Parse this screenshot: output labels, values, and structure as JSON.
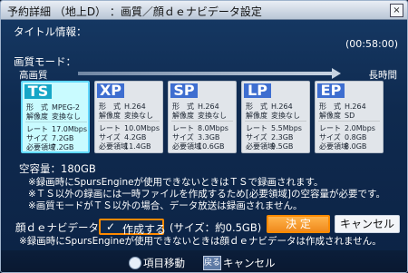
{
  "window": {
    "title": "予約詳細 （地上D） ：画質／顔ｄｅナビデータ設定",
    "close": "×"
  },
  "title_info": {
    "label": "タイトル情報：",
    "duration": "(00:58:00)"
  },
  "quality": {
    "label": "画質モード：",
    "high": "高画質",
    "long": "長時間",
    "modes": [
      {
        "badge": "TS",
        "rows": [
          [
            "形　式",
            "MPEG-2"
          ],
          [
            "解像度",
            "変換なし"
          ],
          [
            "レート",
            "17.0Mbps"
          ],
          [
            "サイズ",
            "7.2GB"
          ],
          [
            "必要領域",
            "7.2GB"
          ]
        ]
      },
      {
        "badge": "XP",
        "rows": [
          [
            "形　式",
            "H.264"
          ],
          [
            "解像度",
            "変換なし"
          ],
          [
            "レート",
            "10.0Mbps"
          ],
          [
            "サイズ",
            "4.2GB"
          ],
          [
            "必要領域",
            "11.4GB"
          ]
        ]
      },
      {
        "badge": "SP",
        "rows": [
          [
            "形　式",
            "H.264"
          ],
          [
            "解像度",
            "変換なし"
          ],
          [
            "レート",
            "8.0Mbps"
          ],
          [
            "サイズ",
            "3.3GB"
          ],
          [
            "必要領域",
            "10.6GB"
          ]
        ]
      },
      {
        "badge": "LP",
        "rows": [
          [
            "形　式",
            "H.264"
          ],
          [
            "解像度",
            "変換なし"
          ],
          [
            "レート",
            "5.5Mbps"
          ],
          [
            "サイズ",
            "2.3GB"
          ],
          [
            "必要領域",
            "9.5GB"
          ]
        ]
      },
      {
        "badge": "EP",
        "rows": [
          [
            "形　式",
            "H.264"
          ],
          [
            "解像度",
            "SD"
          ],
          [
            "レート",
            "2.0Mbps"
          ],
          [
            "サイズ",
            "0.8GB"
          ],
          [
            "必要領域",
            "8.0GB"
          ]
        ]
      }
    ]
  },
  "capacity": {
    "text": "空容量：180GB"
  },
  "notes": [
    "※録画時にSpursEngineが使用できないときはＴＳで録画されます。",
    "※ＴＳ以外の録画には一時ファイルを作成するため[必要領域]の空容量が必要です。",
    "※画質モードがＴＳ以外の場合、データ放送は録画されません。"
  ],
  "face_nav": {
    "label": "顔ｄｅナビデータ",
    "checkbox_label": "作成する",
    "size": "(サイズ：約0.5GB)",
    "note": "※録画時にSpursEngineが使用できないときは顔ｄｅナビデータは作成されません。"
  },
  "buttons": {
    "ok": "決 定",
    "cancel": "キャンセル"
  },
  "footer": {
    "move": "項目移動",
    "return_icon": "戻る",
    "cancel_hint": "キャンセル"
  }
}
